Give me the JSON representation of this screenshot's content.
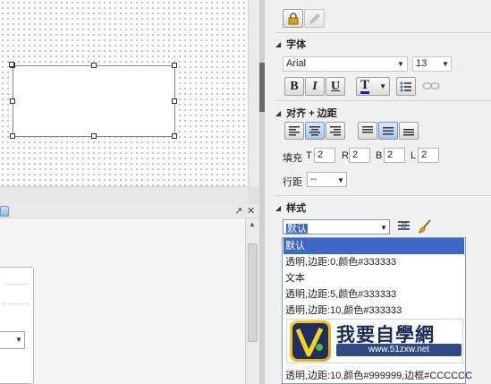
{
  "text_section": {
    "title": "字体",
    "font_family": "Arial",
    "font_size": "13",
    "bold_label": "B",
    "italic_label": "I",
    "underline_label": "U",
    "text_color_label": "T"
  },
  "align_section": {
    "title": "对齐 + 边距",
    "padding_label": "填充",
    "padding_top_label": "T",
    "padding_top_value": "2",
    "padding_right_label": "R",
    "padding_right_value": "2",
    "padding_bottom_label": "B",
    "padding_bottom_value": "2",
    "padding_left_label": "L",
    "padding_left_value": "2",
    "line_spacing_label": "行距",
    "line_spacing_value": "--"
  },
  "style_section": {
    "title": "样式",
    "selected_style": "默认",
    "options": [
      "默认",
      "透明,边距:0,颜色#333333",
      "文本",
      "透明,边距:5,颜色#333333",
      "透明,边距:10,颜色#333333",
      "透明,边距:10,颜色#999999,边框#CCCCCC"
    ],
    "selected_index": 0
  },
  "lower_panel": {
    "control_pin": "↗",
    "control_close": "✕"
  },
  "watermark": {
    "logo_letter": "V",
    "title": "我要自學網",
    "url": "www.51zxw.net"
  },
  "colors": {
    "accent": "#3f68c6",
    "text_color_underline": "#1a1ab8",
    "shape_border": "#6c8fb5"
  },
  "icons": {
    "lock": "lock-icon",
    "edit": "edit-icon",
    "list": "bullet-list-icon",
    "link": "link-icon",
    "style_edit": "style-editor-icon",
    "brush": "brush-icon"
  }
}
